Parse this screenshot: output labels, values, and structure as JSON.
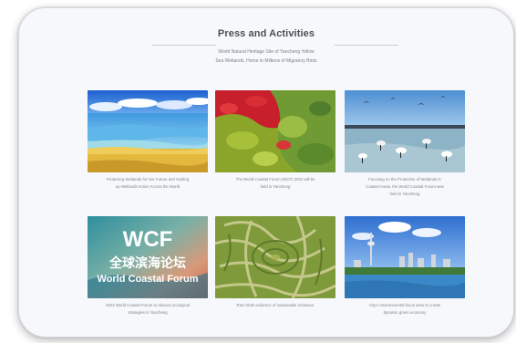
{
  "section": {
    "title": "Press and Activities",
    "subtitle_line1": "World Natural Heritage Site of Yancheng Yellow",
    "subtitle_line2": "Sea Wetlands, Home to Millions of Migratory Birds"
  },
  "articles": [
    {
      "caption_line1": "Protecting Wetlands for Our Future and Scaling",
      "caption_line2": "up Wetlands Action Across the World",
      "caption_line3": "",
      "image_icon": "coastal-wetland-image"
    },
    {
      "caption_line1": "The World Coastal Forum (WCF) 2022 will be",
      "caption_line2": "held in Yancheng",
      "caption_line3": "",
      "image_icon": "red-wetland-image"
    },
    {
      "caption_line1": "Focusing on the Protection of Wetlands in",
      "caption_line2": "Coastal Areas, the World Coastal Forum was",
      "caption_line3": "held in Yancheng",
      "image_icon": "migratory-birds-image"
    },
    {
      "caption_line1": "2022 World Coastal Forum to discuss ecological",
      "caption_line2": "strategies in Yancheng",
      "caption_line3": "",
      "image_icon": "wcf-banner-image",
      "banner": {
        "logo": "WCF",
        "chinese": "全球滨海论坛",
        "english": "World Coastal Forum"
      }
    },
    {
      "caption_line1": "Rare birds evidence of sustainable endeavor",
      "caption_line2": "",
      "caption_line3": "",
      "image_icon": "aerial-maze-wetland-image"
    },
    {
      "caption_line1": "City's environmental focus aims to create",
      "caption_line2": "dynamic green economy",
      "caption_line3": "",
      "image_icon": "city-skyline-image"
    }
  ],
  "colors": {
    "page_background": "#ffffff",
    "card_background": "#f7f8fb",
    "title_text": "#4d4f55",
    "muted_text": "#7f838c",
    "divider": "#c9ccd3"
  }
}
